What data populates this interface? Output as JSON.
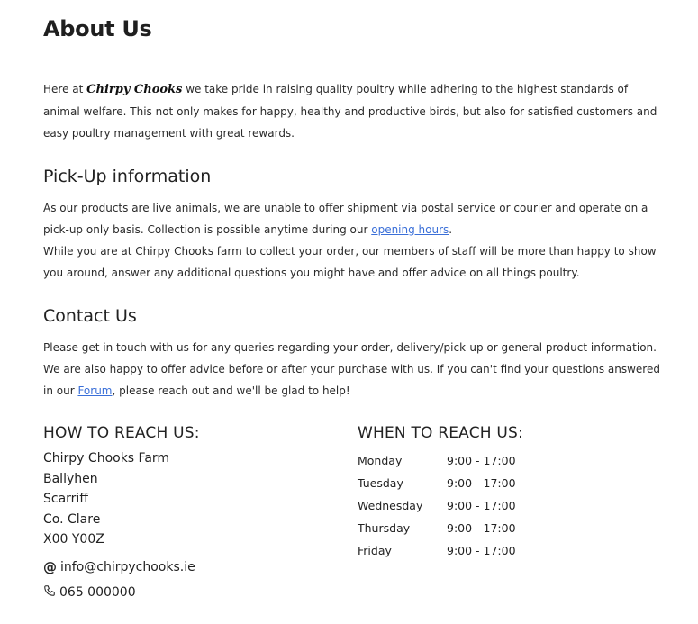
{
  "about": {
    "title": "About Us",
    "intro_prefix": "Here at ",
    "brand": "Chirpy Chooks",
    "intro_rest": " we take pride in raising quality poultry while adhering to the highest standards of animal welfare. This not only makes for happy, healthy and productive birds, but also for satisfied customers and easy poultry management with great rewards."
  },
  "pickup": {
    "title": "Pick-Up information",
    "p1_prefix": "As our products are live animals, we are unable to offer shipment via postal service or courier and operate on a pick-up only basis. Collection is possible anytime during our ",
    "p1_link": "opening hours",
    "p1_suffix": ".",
    "p2": "While you are at Chirpy Chooks farm to collect your order, our members of staff will be more than happy to show you around, answer any additional questions you might have and offer advice on all things poultry."
  },
  "contact": {
    "title": "Contact Us",
    "p1": "Please get in touch with us for any queries regarding your order, delivery/pick-up or general product information.",
    "p2": "We are also happy to offer advice before or after your purchase with us. If you can't find your questions answered in our ",
    "forum_link": "Forum",
    "p2_suffix": ", please reach out and we'll be glad to help!"
  },
  "reach": {
    "title": "HOW TO REACH US:",
    "address": [
      "Chirpy Chooks Farm",
      "Ballyhen",
      "Scarriff",
      "Co. Clare",
      "X00 Y00Z"
    ],
    "email_icon": "at-icon",
    "email": "info@chirpychooks.ie",
    "phone_icon": "phone-icon",
    "phone": "065 000000"
  },
  "when": {
    "title": "WHEN TO REACH US:",
    "hours": [
      {
        "day": "Monday",
        "time": "9:00 - 17:00"
      },
      {
        "day": "Tuesday",
        "time": "9:00 - 17:00"
      },
      {
        "day": "Wednesday",
        "time": "9:00 - 17:00"
      },
      {
        "day": "Thursday",
        "time": "9:00 - 17:00"
      },
      {
        "day": "Friday",
        "time": "9:00 - 17:00"
      }
    ]
  },
  "colors": {
    "link": "#3a6fd8",
    "text": "#222222"
  }
}
